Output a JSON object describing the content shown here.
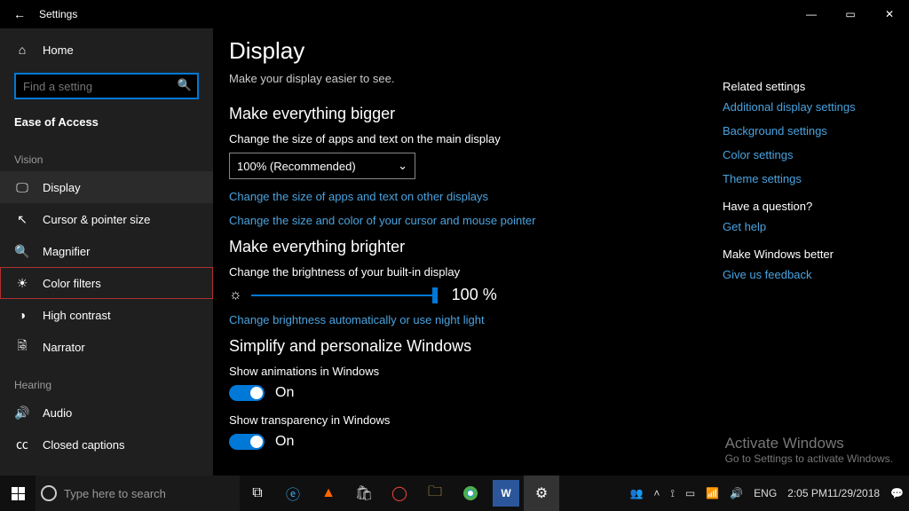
{
  "titlebar": {
    "title": "Settings"
  },
  "sidebar": {
    "home": "Home",
    "search_placeholder": "Find a setting",
    "category": "Ease of Access",
    "groups": [
      {
        "label": "Vision",
        "items": [
          {
            "icon": "🖵",
            "label": "Display",
            "selected": true
          },
          {
            "icon": "↖",
            "label": "Cursor & pointer size"
          },
          {
            "icon": "🔍",
            "label": "Magnifier"
          },
          {
            "icon": "☀",
            "label": "Color filters",
            "highlighted": true
          },
          {
            "icon": "◑",
            "label": "High contrast"
          },
          {
            "icon": "🗟",
            "label": "Narrator"
          }
        ]
      },
      {
        "label": "Hearing",
        "items": [
          {
            "icon": "🔊",
            "label": "Audio"
          },
          {
            "icon": "㏄",
            "label": "Closed captions"
          }
        ]
      }
    ]
  },
  "content": {
    "title": "Display",
    "subtitle": "Make your display easier to see.",
    "section1": {
      "heading": "Make everything bigger",
      "label": "Change the size of apps and text on the main display",
      "dropdown_value": "100% (Recommended)",
      "link1": "Change the size of apps and text on other displays",
      "link2": "Change the size and color of your cursor and mouse pointer"
    },
    "section2": {
      "heading": "Make everything brighter",
      "label": "Change the brightness of your built-in display",
      "slider_value": "100 %",
      "link": "Change brightness automatically or use night light"
    },
    "section3": {
      "heading": "Simplify and personalize Windows",
      "opt1_label": "Show animations in Windows",
      "opt1_state": "On",
      "opt2_label": "Show transparency in Windows",
      "opt2_state": "On"
    }
  },
  "rail": {
    "related_heading": "Related settings",
    "related": [
      "Additional display settings",
      "Background settings",
      "Color settings",
      "Theme settings"
    ],
    "question_heading": "Have a question?",
    "question_link": "Get help",
    "better_heading": "Make Windows better",
    "better_link": "Give us feedback"
  },
  "watermark": {
    "l1": "Activate Windows",
    "l2": "Go to Settings to activate Windows."
  },
  "taskbar": {
    "search_placeholder": "Type here to search",
    "lang": "ENG",
    "time": "2:05 PM",
    "date": "11/29/2018"
  }
}
